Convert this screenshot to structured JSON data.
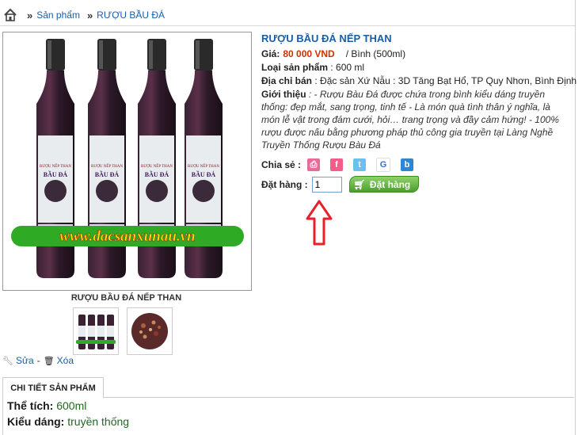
{
  "breadcrumb": {
    "items": [
      "Sản phẩm",
      "RƯỢU BẦU ĐÁ"
    ],
    "separator": "»"
  },
  "product": {
    "title": "RƯỢU BẦU ĐÁ NẾP THAN",
    "price_label": "Giá:",
    "price": "80 000 VND",
    "unit": "/ Bình (500ml)",
    "type_label": "Loại sản phẩm",
    "type_value": ": 600 ml",
    "seller_label": "Địa chỉ bán",
    "seller_value": ": Đặc sản Xứ Nẫu : 3D Tăng Bạt Hổ, TP Quy Nhơn, Bình Định",
    "intro_label": "Giới thiệu",
    "intro_value": ": - Rượu Bàu Đá được chứa trong bình kiểu dáng truyền thống: đẹp mắt, sang trọng, tinh tế - Là món quà tình thân ý nghĩa, là món lễ vật trong đám cưới, hỏi… trang trọng và đầy cảm hứng! - 100% rượu được nấu bằng phương pháp thủ công gia truyền tại Làng Nghề Truyền Thống Rượu Bàu Đá",
    "share_label": "Chia sẻ :",
    "order_label": "Đặt hàng :",
    "order_qty": "1",
    "order_button": "Đặt hàng",
    "image_caption": "RƯỢU BẦU ĐÁ NẾP THAN",
    "image_watermark": "www.dacsanxunau.vn",
    "bottle_label_line1": "RƯỢU NẾP THAN",
    "bottle_label_line2": "BẦU ĐÁ"
  },
  "admin": {
    "edit": "Sửa",
    "separator": "-",
    "delete": "Xóa"
  },
  "details": {
    "tab_label": "CHI TIẾT SẢN PHẨM",
    "volume_label": "Thể tích:",
    "volume_value": "600ml",
    "style_label": "Kiểu dáng:",
    "style_value": "truyền thống"
  },
  "share_icons": [
    "print-icon",
    "facebook-icon",
    "twitter-icon",
    "google-icon",
    "bookmark-icon"
  ],
  "colors": {
    "link": "#1a5ea8",
    "price": "#cc3300",
    "button": "#4aa02c",
    "arrow": "#e8202a",
    "watermark": "#ffe600",
    "watermark_band": "#2faa24"
  }
}
